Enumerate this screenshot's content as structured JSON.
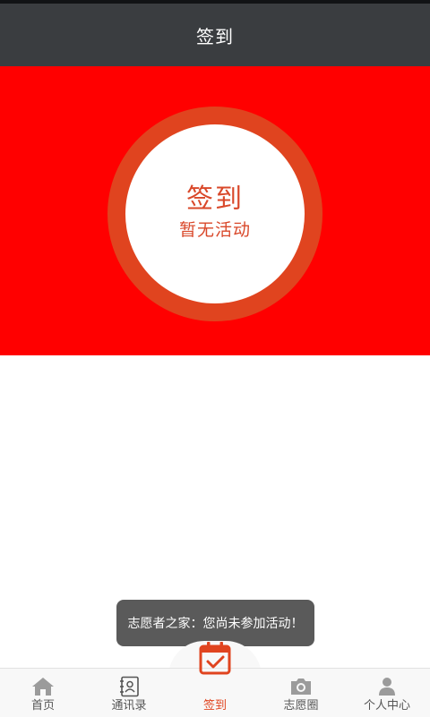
{
  "header": {
    "title": "签到"
  },
  "checkin": {
    "title": "签到",
    "subtitle": "暂无活动"
  },
  "toast": {
    "message": "志愿者之家：您尚未参加活动！"
  },
  "tabs": [
    {
      "label": "首页",
      "icon": "home-icon"
    },
    {
      "label": "通讯录",
      "icon": "contacts-icon"
    },
    {
      "label": "签到",
      "icon": "calendar-check-icon",
      "active": true
    },
    {
      "label": "志愿圈",
      "icon": "camera-icon"
    },
    {
      "label": "个人中心",
      "icon": "person-icon"
    }
  ],
  "colors": {
    "title_bar": "#3a3d40",
    "banner": "#ff0000",
    "accent": "#e0441f",
    "toast_bg": "#5a5a5a"
  }
}
